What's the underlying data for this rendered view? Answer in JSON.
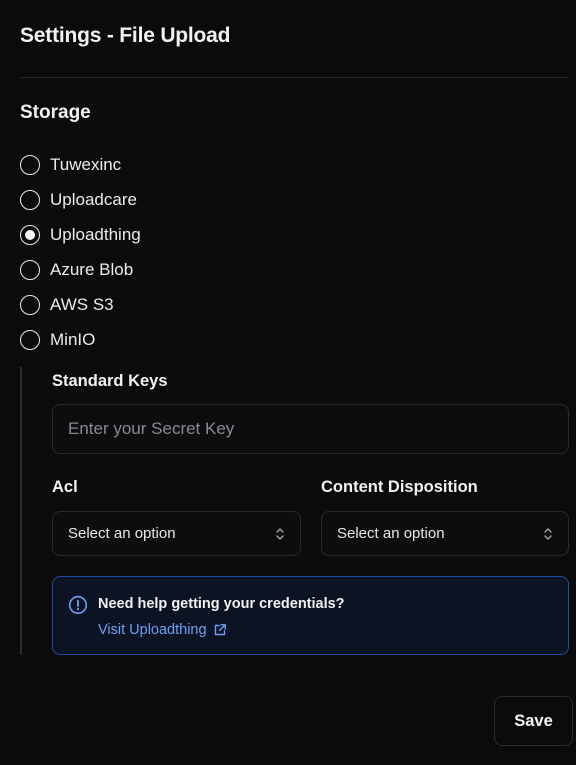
{
  "header": {
    "title": "Settings - File Upload"
  },
  "storage": {
    "title": "Storage",
    "options": [
      {
        "label": "Tuwexinc",
        "checked": false
      },
      {
        "label": "Uploadcare",
        "checked": false
      },
      {
        "label": "Uploadthing",
        "checked": true
      },
      {
        "label": "Azure Blob",
        "checked": false
      },
      {
        "label": "AWS S3",
        "checked": false
      },
      {
        "label": "MinIO",
        "checked": false
      }
    ]
  },
  "config": {
    "standard_keys_label": "Standard Keys",
    "secret_key_placeholder": "Enter your Secret Key",
    "secret_key_value": "",
    "acl_label": "Acl",
    "acl_value": "Select an option",
    "content_disposition_label": "Content Disposition",
    "content_disposition_value": "Select an option"
  },
  "help": {
    "title": "Need help getting your credentials?",
    "link_label": "Visit Uploadthing"
  },
  "actions": {
    "save_label": "Save"
  },
  "colors": {
    "background": "#0b0b0c",
    "accent_link": "#6aa0f5",
    "help_border": "#1f4ba3",
    "help_background": "#0c1424"
  }
}
